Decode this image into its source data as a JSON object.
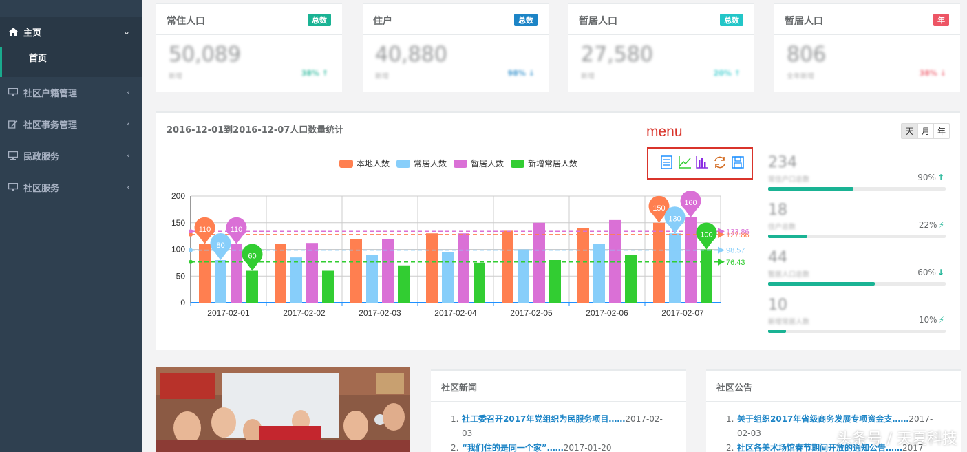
{
  "colors": {
    "sidebar_bg": "#2f4050",
    "accent": "#1ab394",
    "local": "#ff7f50",
    "permanent": "#87cefa",
    "temporary": "#da70d6",
    "new_permanent": "#32cd32",
    "annotation_red": "#d9342b"
  },
  "sidebar": {
    "items": [
      {
        "label": "主页",
        "icon": "home-icon",
        "arrow": "⌄",
        "active": true
      },
      {
        "label": "社区户籍管理",
        "icon": "desktop-icon",
        "arrow": "‹"
      },
      {
        "label": "社区事务管理",
        "icon": "edit-icon",
        "arrow": "‹"
      },
      {
        "label": "民政服务",
        "icon": "desktop-icon",
        "arrow": "‹"
      },
      {
        "label": "社区服务",
        "icon": "desktop-icon",
        "arrow": "‹"
      }
    ],
    "sub_item": "首页"
  },
  "stats": [
    {
      "title": "常住人口",
      "badge": "总数",
      "badge_color": "#1ab394",
      "value": "50,089",
      "sub": "新增",
      "pct": "38% ↑",
      "pct_color": "#1ab394"
    },
    {
      "title": "住户",
      "badge": "总数",
      "badge_color": "#1c84c6",
      "value": "40,880",
      "sub": "新增",
      "pct": "98% ↓",
      "pct_color": "#1c84c6"
    },
    {
      "title": "暂居人口",
      "badge": "总数",
      "badge_color": "#23c6c8",
      "value": "27,580",
      "sub": "新增",
      "pct": "20% ↑",
      "pct_color": "#23c6c8"
    },
    {
      "title": "暂居人口",
      "badge": "年",
      "badge_color": "#ed5565",
      "value": "806",
      "sub": "全年新增",
      "pct": "38% ↓",
      "pct_color": "#ed5565"
    }
  ],
  "panel": {
    "title": "2016-12-01到2016-12-07人口数量统计",
    "range_buttons": [
      "天",
      "月",
      "年"
    ],
    "menu_annotation": "menu",
    "toolbox": [
      "data-view-icon",
      "line-chart-icon",
      "bar-chart-icon",
      "restore-icon",
      "save-image-icon"
    ]
  },
  "chart_data": {
    "type": "bar",
    "categories": [
      "2017-02-01",
      "2017-02-02",
      "2017-02-03",
      "2017-02-04",
      "2017-02-05",
      "2017-02-06",
      "2017-02-07"
    ],
    "series": [
      {
        "name": "本地人数",
        "color": "#ff7f50",
        "values": [
          110,
          110,
          120,
          130,
          135,
          140,
          150
        ]
      },
      {
        "name": "常居人数",
        "color": "#87cefa",
        "values": [
          80,
          85,
          90,
          95,
          100,
          110,
          130
        ]
      },
      {
        "name": "暂居人数",
        "color": "#da70d6",
        "values": [
          110,
          112,
          120,
          130,
          150,
          155,
          160
        ]
      },
      {
        "name": "新增常居人数",
        "color": "#32cd32",
        "values": [
          60,
          60,
          70,
          75,
          80,
          90,
          100
        ]
      }
    ],
    "ylim": [
      0,
      200
    ],
    "yticks": [
      0,
      50,
      100,
      150,
      200
    ],
    "mark_points": [
      {
        "series": 0,
        "index": 0,
        "label": "110"
      },
      {
        "series": 1,
        "index": 0,
        "label": "80"
      },
      {
        "series": 2,
        "index": 0,
        "label": "110"
      },
      {
        "series": 3,
        "index": 0,
        "label": "60"
      },
      {
        "series": 0,
        "index": 6,
        "label": "150"
      },
      {
        "series": 1,
        "index": 6,
        "label": "130"
      },
      {
        "series": 2,
        "index": 6,
        "label": "160"
      },
      {
        "series": 3,
        "index": 6,
        "label": "100"
      }
    ],
    "mark_lines": [
      {
        "series": 2,
        "value": 133.86,
        "label": "133.86"
      },
      {
        "series": 0,
        "value": 127.86,
        "label": "127.86"
      },
      {
        "series": 1,
        "value": 98.57,
        "label": "98.57"
      },
      {
        "series": 3,
        "value": 76.43,
        "label": "76.43"
      }
    ]
  },
  "right_stats": [
    {
      "value": "234",
      "label": "常住户口总数",
      "pct": "90%",
      "arrow": "↑",
      "fill": 0.48
    },
    {
      "value": "18",
      "label": "住户总数",
      "pct": "22%",
      "arrow": "⚡",
      "fill": 0.22
    },
    {
      "value": "44",
      "label": "暂居人口总数",
      "pct": "60%",
      "arrow": "↓",
      "fill": 0.6
    },
    {
      "value": "10",
      "label": "新增常居人数",
      "pct": "10%",
      "arrow": "⚡",
      "fill": 0.1
    }
  ],
  "news": {
    "title": "社区新闻",
    "items": [
      {
        "title": "社工委召开2017年党组织为民服务项目……",
        "date": "2017-02-03"
      },
      {
        "title": "“我们住的是同一个家”……",
        "date": "2017-01-20"
      }
    ]
  },
  "notices": {
    "title": "社区公告",
    "items": [
      {
        "title": "关于组织2017年省级商务发展专项资金支……",
        "date": "2017-02-03"
      },
      {
        "title": "社区各美术场馆春节期间开放的通知公告……",
        "date": "2017"
      }
    ]
  },
  "watermark": "头条号 / 天夏科技"
}
